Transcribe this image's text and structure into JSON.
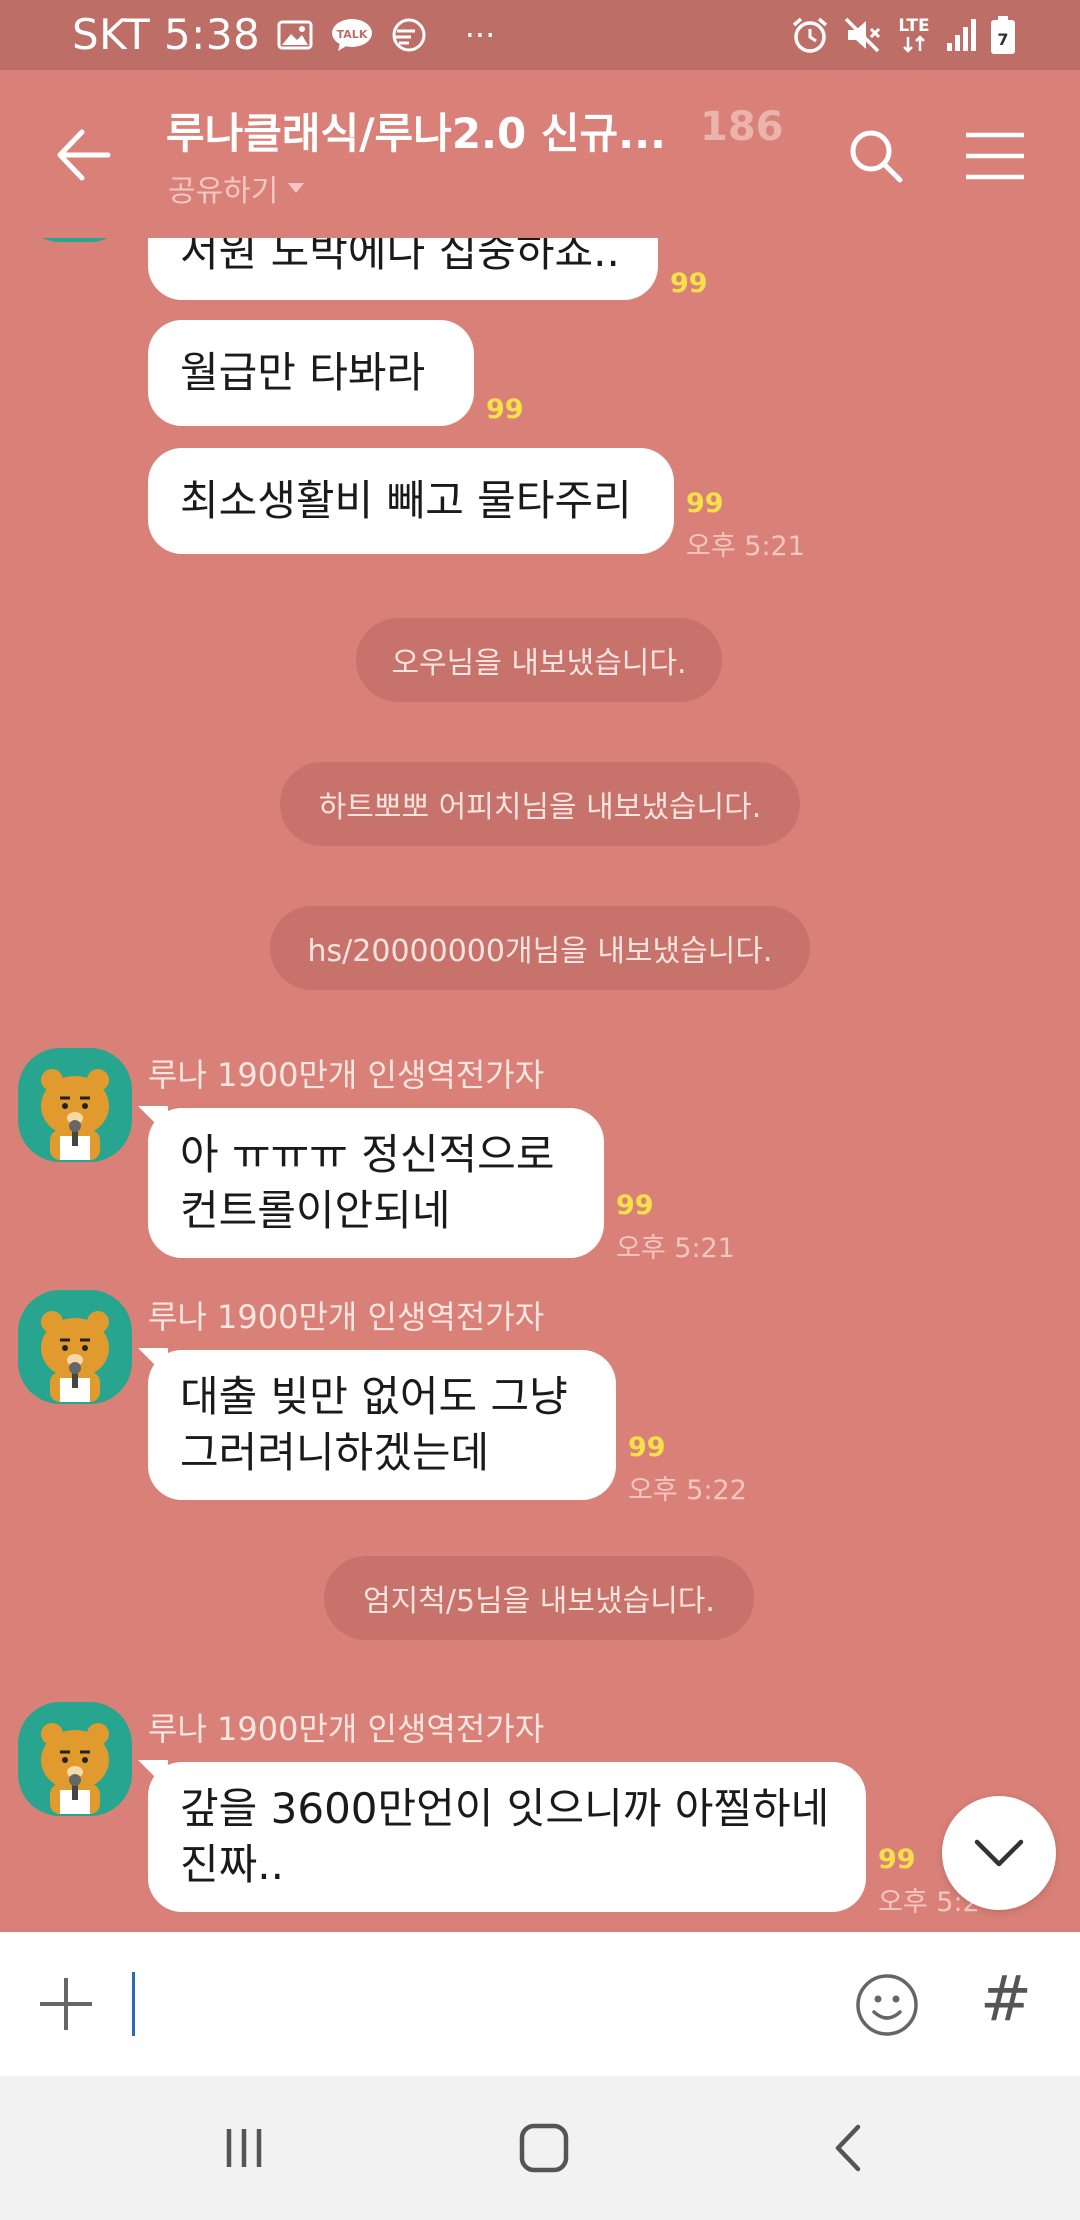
{
  "status_bar": {
    "carrier_time": "SKT 5:38",
    "talk_badge": "TALK",
    "more": "···",
    "lte": "LTE",
    "battery_level": "7"
  },
  "header": {
    "title": "루나클래식/루나2.0 신규...",
    "member_count": "186",
    "share_label": "공유하기"
  },
  "messages": [
    {
      "text": "서원 도박에다 집중하죠..",
      "unread": "99"
    },
    {
      "text": "월급만 타봐라",
      "unread": "99"
    },
    {
      "text": "최소생활비 빼고 물타주리",
      "unread": "99",
      "time": "오후 5:21"
    }
  ],
  "system_messages": [
    "오우님을 내보냈습니다.",
    "하트뽀뽀 어피치님을 내보냈습니다.",
    "hs/20000000개님을 내보냈습니다.",
    "엄지척/5님을 내보냈습니다."
  ],
  "member_messages": [
    {
      "sender": "루나 1900만개 인생역전가자",
      "lines": [
        "아 ㅠㅠㅠ 정신적으로",
        "컨트롤이안되네"
      ],
      "unread": "99",
      "time": "오후 5:21"
    },
    {
      "sender": "루나 1900만개 인생역전가자",
      "lines": [
        "대출 빚만 없어도 그냥",
        "그러려니하겠는데"
      ],
      "unread": "99",
      "time": "오후 5:22"
    },
    {
      "sender": "루나 1900만개 인생역전가자",
      "lines": [
        "갚을 3600만언이 잇으니까 아찔하네",
        "진짜.."
      ],
      "unread": "99",
      "time": "오후 5:2"
    }
  ],
  "input": {
    "value": "",
    "placeholder": "",
    "hash": "#"
  },
  "colors": {
    "chat_bg": "#d98178",
    "status_bg": "#bd6e66",
    "unread": "#f6e14a",
    "avatar_bg": "#27a58f",
    "system_bubble": "#c7726a"
  },
  "icons": [
    "back-arrow-icon",
    "search-icon",
    "hamburger-menu-icon",
    "plus-icon",
    "emoji-icon",
    "hash-icon",
    "chevron-down-icon",
    "recents-icon",
    "home-icon",
    "back-nav-icon"
  ]
}
